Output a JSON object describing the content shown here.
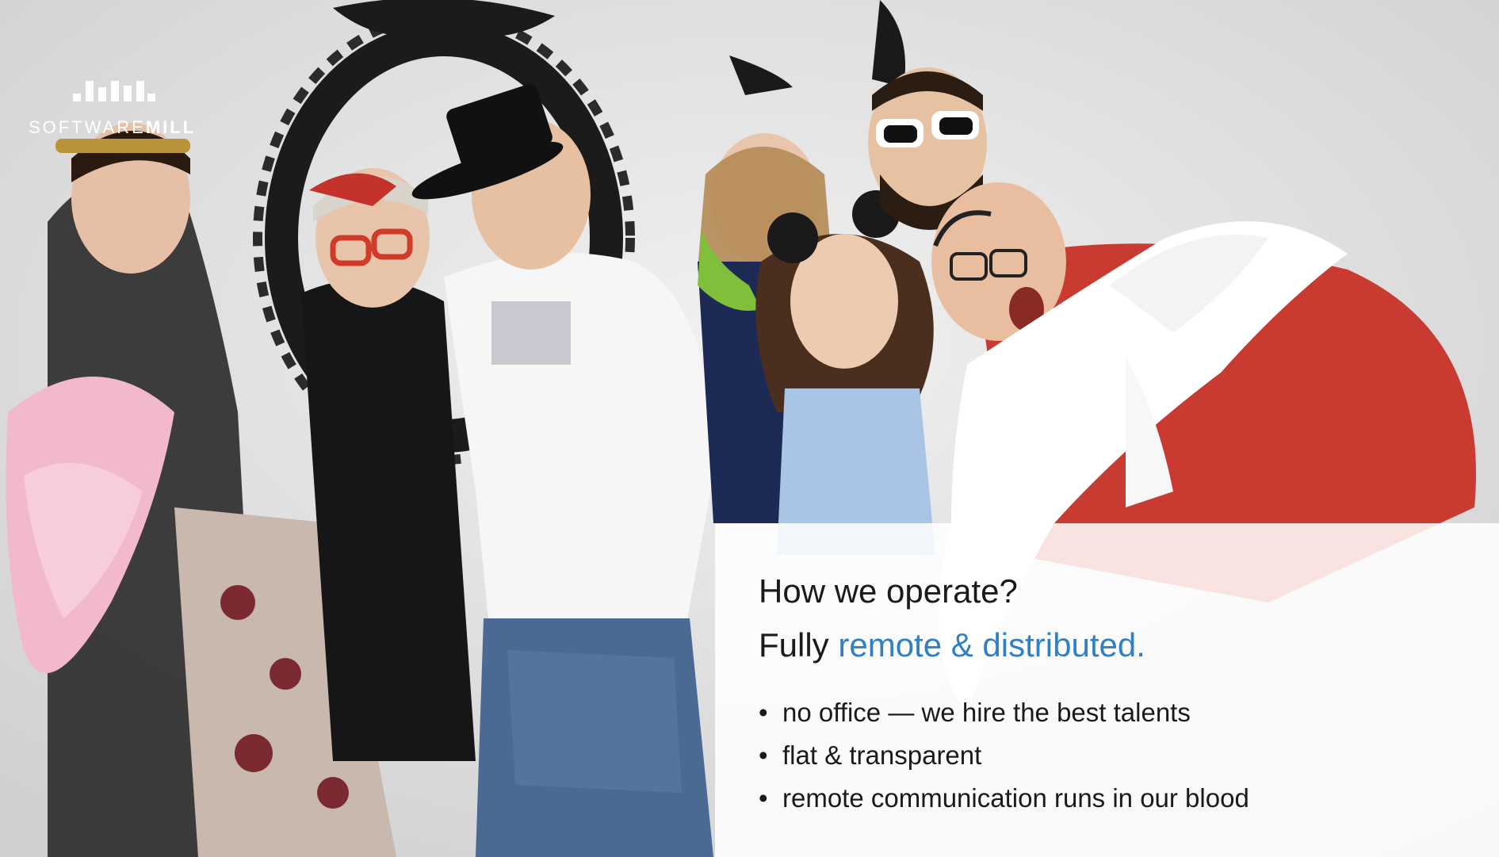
{
  "logo": {
    "wordmark_light": "SOFTWARE",
    "wordmark_bold": "MILL"
  },
  "panel": {
    "title": "How we operate?",
    "subtitle_plain": "Fully ",
    "subtitle_accent": "remote & distributed.",
    "bullet_marker": "•",
    "bullets": [
      "no office — we hire the best talents",
      "flat & transparent",
      "remote communication runs in our blood"
    ]
  },
  "colors": {
    "accent": "#2f80c4",
    "text": "#1a1a1a",
    "panel_background": "rgba(255,255,255,0.86)"
  },
  "photo": {
    "description_icon": "team-photo"
  }
}
